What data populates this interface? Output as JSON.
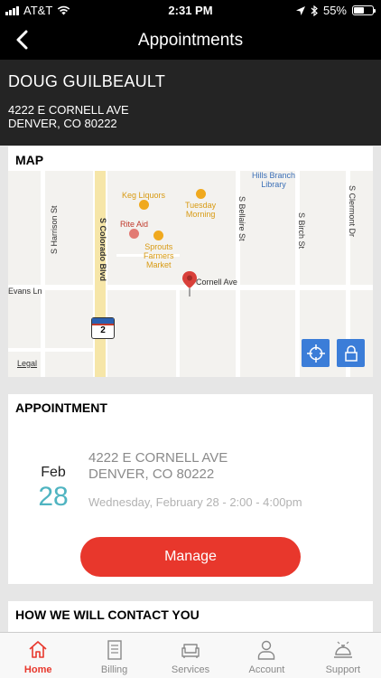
{
  "status_bar": {
    "carrier": "AT&T",
    "time": "2:31 PM",
    "battery": "55%",
    "battery_level": 0.55
  },
  "nav": {
    "title": "Appointments"
  },
  "customer": {
    "name": "DOUG GUILBEAULT",
    "address_line1": "4222 E CORNELL AVE",
    "address_line2": "DENVER, CO 80222"
  },
  "map": {
    "title": "MAP",
    "labels": {
      "library": "Hills Branch\nLibrary",
      "keg": "Keg Liquors",
      "tuesday": "Tuesday\nMorning",
      "rite_aid": "Rite Aid",
      "sprouts": "Sprouts\nFarmers\nMarket",
      "colorado": "S Colorado Blvd",
      "harrison": "S Harrison St",
      "bellaire": "S Bellaire St",
      "birch": "S Birch St",
      "clermont": "S Clermont Dr",
      "cornell": "Cornell Ave",
      "evans": "Evans Ln",
      "route": "2",
      "legal": "Legal"
    }
  },
  "appointment": {
    "title": "APPOINTMENT",
    "month": "Feb",
    "day": "28",
    "address_line1": "4222 E CORNELL AVE",
    "address_line2": "DENVER, CO 80222",
    "time": "Wednesday, February 28 - 2:00 - 4:00pm",
    "manage_label": "Manage"
  },
  "contact": {
    "title": "HOW WE WILL CONTACT YOU"
  },
  "tabs": [
    {
      "label": "Home",
      "icon": "home-icon",
      "active": true
    },
    {
      "label": "Billing",
      "icon": "billing-icon",
      "active": false
    },
    {
      "label": "Services",
      "icon": "sofa-icon",
      "active": false
    },
    {
      "label": "Account",
      "icon": "person-icon",
      "active": false
    },
    {
      "label": "Support",
      "icon": "service-bell-icon",
      "active": false
    }
  ],
  "colors": {
    "accent": "#e8372c",
    "date_day": "#4fb4c1",
    "map_button": "#3b7dd8"
  }
}
